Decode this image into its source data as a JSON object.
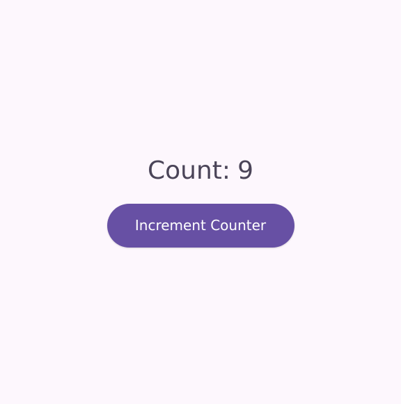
{
  "counter": {
    "label": "Count:",
    "value": "9",
    "button_label": "Increment Counter"
  },
  "colors": {
    "background": "#fdf7fd",
    "text": "#4a4458",
    "button": "#6750a4",
    "button_text": "#ffffff"
  }
}
